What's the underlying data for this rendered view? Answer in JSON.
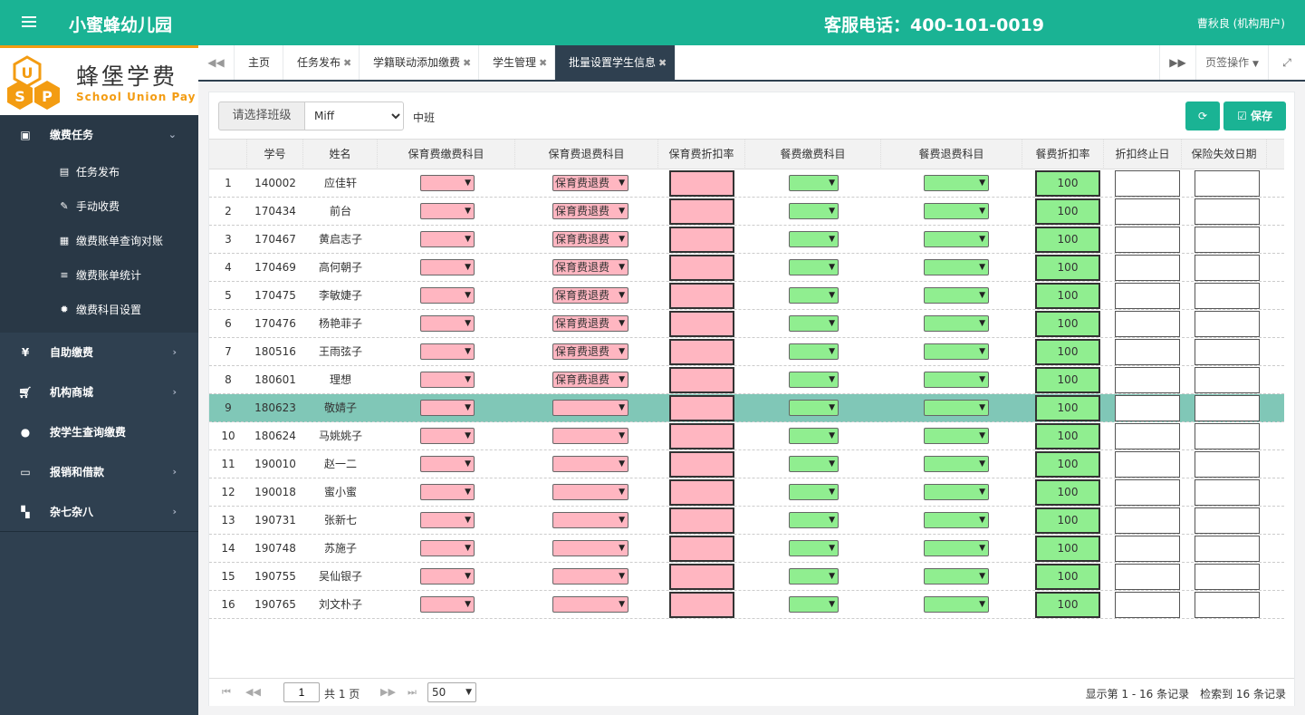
{
  "header": {
    "app_title": "小蜜蜂幼儿园",
    "hotline": "客服电话：400-101-0019",
    "user": "曹秋良 (机构用户)"
  },
  "logo": {
    "cn": "蜂堡学费",
    "en": "School Union Pay"
  },
  "sidebar": {
    "groups": [
      {
        "label": "缴费任务",
        "icon": "money-icon",
        "open": true,
        "children": [
          {
            "label": "任务发布",
            "icon": "file-icon"
          },
          {
            "label": "手动收费",
            "icon": "edit-icon"
          },
          {
            "label": "缴费账单查询对账",
            "icon": "document-icon"
          },
          {
            "label": "缴费账单统计",
            "icon": "list-icon"
          },
          {
            "label": "缴费科目设置",
            "icon": "gear-icon"
          }
        ]
      },
      {
        "label": "自助缴费",
        "icon": "yen-icon"
      },
      {
        "label": "机构商城",
        "icon": "cart-icon"
      },
      {
        "label": "按学生查询缴费",
        "icon": "user-icon"
      },
      {
        "label": "报销和借款",
        "icon": "card-icon"
      },
      {
        "label": "杂七杂八",
        "icon": "grid-icon"
      }
    ]
  },
  "tabs": {
    "items": [
      "主页",
      "任务发布",
      "学籍联动添加缴费",
      "学生管理",
      "批量设置学生信息"
    ],
    "page_ops": "页签操作"
  },
  "toolbar": {
    "class_label": "请选择班级",
    "class_value": "Miff",
    "class_name": "中班",
    "save_label": "保存"
  },
  "table": {
    "headers": [
      "学号",
      "姓名",
      "保育费缴费科目",
      "保育费退费科目",
      "保育费折扣率",
      "餐费缴费科目",
      "餐费退费科目",
      "餐费折扣率",
      "折扣终止日",
      "保险失效日期"
    ],
    "refund_option": "保育费退费",
    "discount": "100",
    "selected_row": 9,
    "rows": [
      {
        "no": "1",
        "id": "140002",
        "name": "应佳轩",
        "refund": true
      },
      {
        "no": "2",
        "id": "170434",
        "name": "前台",
        "refund": true
      },
      {
        "no": "3",
        "id": "170467",
        "name": "黄启志子",
        "refund": true
      },
      {
        "no": "4",
        "id": "170469",
        "name": "高何朝子",
        "refund": true
      },
      {
        "no": "5",
        "id": "170475",
        "name": "李敏婕子",
        "refund": true
      },
      {
        "no": "6",
        "id": "170476",
        "name": "杨艳菲子",
        "refund": true
      },
      {
        "no": "7",
        "id": "180516",
        "name": "王雨弦子",
        "refund": true
      },
      {
        "no": "8",
        "id": "180601",
        "name": "理想",
        "refund": true
      },
      {
        "no": "9",
        "id": "180623",
        "name": "敬婧子",
        "refund": false
      },
      {
        "no": "10",
        "id": "180624",
        "name": "马姚姚子",
        "refund": false
      },
      {
        "no": "11",
        "id": "190010",
        "name": "赵一二",
        "refund": false
      },
      {
        "no": "12",
        "id": "190018",
        "name": "蜜小蜜",
        "refund": false
      },
      {
        "no": "13",
        "id": "190731",
        "name": "张新七",
        "refund": false
      },
      {
        "no": "14",
        "id": "190748",
        "name": "苏施子",
        "refund": false
      },
      {
        "no": "15",
        "id": "190755",
        "name": "吴仙银子",
        "refund": false
      },
      {
        "no": "16",
        "id": "190765",
        "name": "刘文朴子",
        "refund": false
      }
    ]
  },
  "pager": {
    "page": "1",
    "total_pages": "共 1 页",
    "page_size": "50",
    "info": "显示第 1 - 16 条记录　检索到 16 条记录"
  },
  "colors": {
    "brand": "#1ab394",
    "sidebar": "#2f4050",
    "pink": "#ffb6c1",
    "green": "#90ee90",
    "selected": "#80c7b7"
  }
}
